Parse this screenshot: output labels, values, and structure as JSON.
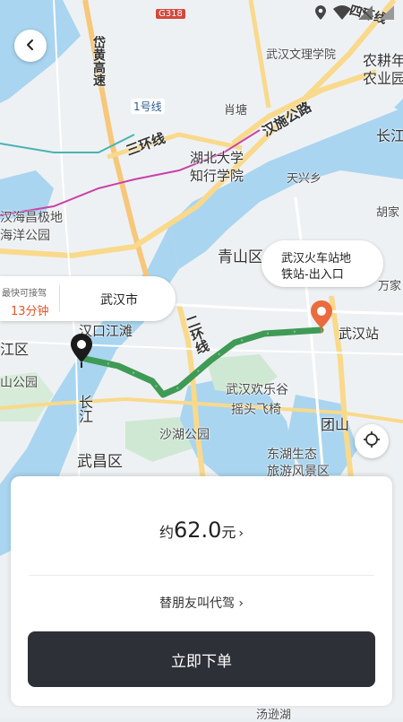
{
  "map": {
    "labels": {
      "wuhan_wenli": "武汉文理学院",
      "nongken": "农耕年",
      "nongye": "农业园",
      "daihuang": "岱黄高速",
      "line1": "1号线",
      "xiaotang": "肖塘",
      "hanshi": "汉施公路",
      "sanhuan": "三环线",
      "hubei_univ_1": "湖北大学",
      "hubei_univ_2": "知行学院",
      "changjiang_top": "长江",
      "tianxing": "天兴乡",
      "hujia": "胡家",
      "hanhai_1": "汉海昌极地",
      "hanhai_2": "海洋公园",
      "qingshan": "青山区",
      "wanjia": "万家",
      "hankou_jiangtan": "汉口江滩",
      "erhuan": "二环线",
      "wuhan_station": "武汉站",
      "jiang_area": "江区",
      "shan_park": "山公园",
      "changjiang_mid": "长江",
      "wuhan_happy": "武汉欢乐谷",
      "yaotou": "摇头飞椅",
      "tuanshan": "团山",
      "shahu": "沙湖公园",
      "wuchang": "武昌区",
      "donghu_1": "东湖生态",
      "donghu_2": "旅游风景区",
      "g318": "G318",
      "sihuan": "四环线",
      "tangxun": "汤逊湖"
    }
  },
  "icons": {
    "back": "chevron-left-icon",
    "locate": "crosshair-icon",
    "start_marker": "start-pin-icon",
    "end_marker": "destination-pin-icon"
  },
  "colors": {
    "route": "#3f9a56",
    "eta": "#e2562b",
    "order_button": "#2e3038"
  },
  "pickup_bubble": {
    "caption": "最快可接驾",
    "eta": "13分钟",
    "city": "武汉市"
  },
  "destination_bubble": {
    "line1": "武汉火车站地",
    "line2": "铁站-出入口"
  },
  "panel": {
    "price_prefix": "约",
    "price_value": "62.0",
    "price_unit": "元",
    "price_arrow": "›",
    "friend_label": "替朋友叫代驾 ›",
    "order_label": "立即下单"
  }
}
